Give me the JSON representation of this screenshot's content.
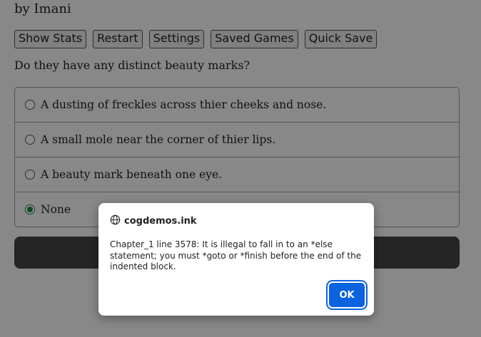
{
  "story": {
    "byline": "by Imani",
    "toolbar": [
      "Show Stats",
      "Restart",
      "Settings",
      "Saved Games",
      "Quick Save"
    ],
    "question": "Do they have any distinct beauty marks?",
    "choices": [
      {
        "label": "A dusting of freckles across thier cheeks and nose.",
        "selected": false
      },
      {
        "label": "A small mole near the corner of thier lips.",
        "selected": false
      },
      {
        "label": "A beauty mark beneath one eye.",
        "selected": false
      },
      {
        "label": "None",
        "selected": true
      }
    ]
  },
  "dialog": {
    "origin": "cogdemos.ink",
    "origin_icon": "globe-icon",
    "message": "Chapter_1 line 3578: It is illegal to fall in to an *else statement; you must *goto or *finish before the end of the indented block.",
    "ok_label": "OK"
  },
  "colors": {
    "selected_radio": "#1f8a3c",
    "ok_button": "#0b63e0",
    "next_button": "#444444"
  }
}
